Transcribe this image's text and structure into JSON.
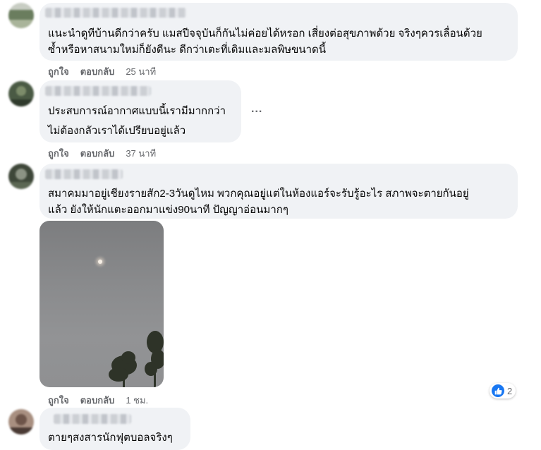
{
  "colors": {
    "bubble": "#f0f2f5",
    "action_text": "#65676b",
    "like_blue": "#1877f2"
  },
  "comments": [
    {
      "lines": [
        "แนะนำดูทีบ้านดีกว่าครับ แมสปีจจุบันก็กันไม่ค่อยได้หรอก เสี่ยงต่อสุขภาพด้วย จริงๆควรเลื่อนด้วย",
        "ซ้ำหรือหาสนามใหม่ก็ยังดีนะ ดีกว่าเตะที่เดิมและมลพิษขนาดนี้"
      ],
      "like_label": "ถูกใจ",
      "reply_label": "ตอบกลับ",
      "time": "25 นาที"
    },
    {
      "lines": [
        "ประสบการณ์อากาศแบบนี้เรามีมากกว่า",
        "ไม่ต้องกลัวเราได้เปรียบอยู่แล้ว"
      ],
      "like_label": "ถูกใจ",
      "reply_label": "ตอบกลับ",
      "time": "37 นาที",
      "more_label": "..."
    },
    {
      "lines": [
        "สมาคมมาอยู่เชียงรายสัก2-3วันดูไหม พวกคุณอยู่แต่ในห้องแอร์จะรับรู้อะไร สภาพจะตายกันอยู่",
        "แล้ว ยังให้นักแตะออกมาแข่ง90นาที ปัญญาอ่อนมากๆ"
      ],
      "like_label": "ถูกใจ",
      "reply_label": "ตอบกลับ",
      "time": "1 ชม.",
      "reaction_icon": "like-icon",
      "reaction_count": "2"
    },
    {
      "lines": [
        "ตายๆสงสารนักฟุตบอลจริงๆ"
      ]
    }
  ]
}
